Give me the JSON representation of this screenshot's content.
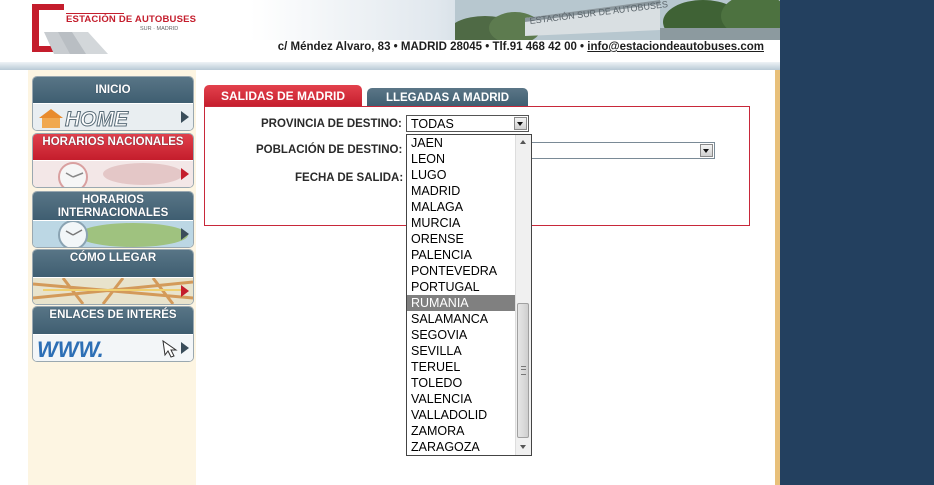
{
  "header": {
    "brand": "ESTACIÓN DE AUTOBUSES",
    "brand_sub": "SUR · MADRID",
    "banner_sign": "ESTACIÓN SUR DE AUTOBUSES",
    "contact_address": "c/ Méndez Alvaro, 83 • MADRID 28045 • Tlf.91 468 42 00 • ",
    "contact_email": "info@estaciondeautobuses.com"
  },
  "menu": {
    "items": [
      {
        "label": "INICIO",
        "image_text": "HOME"
      },
      {
        "label": "HORARIOS NACIONALES"
      },
      {
        "label": "HORARIOS INTERNACIONALES"
      },
      {
        "label": "CÓMO LLEGAR"
      },
      {
        "label": "ENLACES DE INTERÉS",
        "image_text": "WWW."
      }
    ]
  },
  "tabs": {
    "salidas": "SALIDAS DE MADRID",
    "llegadas": "LLEGADAS A MADRID"
  },
  "form": {
    "provincia_label": "PROVINCIA DE DESTINO:",
    "provincia_value": "TODAS",
    "poblacion_label": "POBLACIÓN DE DESTINO:",
    "fecha_label": "FECHA DE SALIDA:"
  },
  "dropdown": {
    "options": [
      "JAEN",
      "LEON",
      "LUGO",
      "MADRID",
      "MALAGA",
      "MURCIA",
      "ORENSE",
      "PALENCIA",
      "PONTEVEDRA",
      "PORTUGAL",
      "RUMANIA",
      "SALAMANCA",
      "SEGOVIA",
      "SEVILLA",
      "TERUEL",
      "TOLEDO",
      "VALENCIA",
      "VALLADOLID",
      "ZAMORA",
      "ZARAGOZA"
    ],
    "highlighted": "RUMANIA"
  },
  "colors": {
    "accent_red": "#c41d2c",
    "menu_blue": "#3f5e71",
    "page_background": "#23405f",
    "sidebar_bg": "#fdf5e2"
  }
}
